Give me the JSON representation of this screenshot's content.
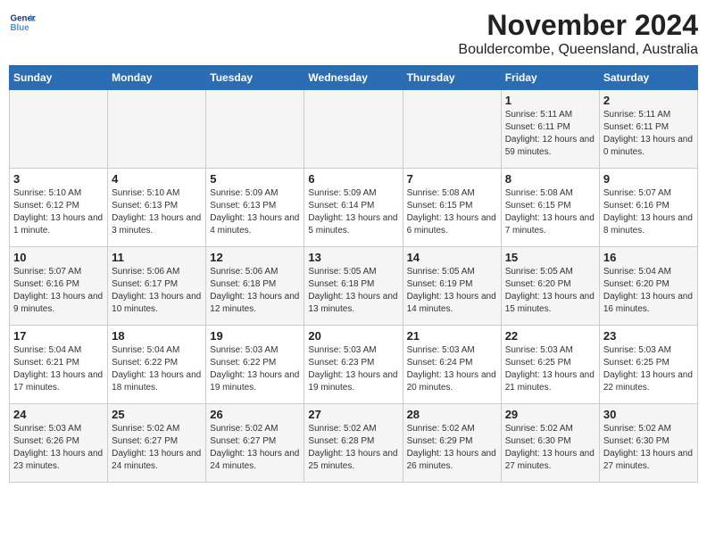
{
  "logo": {
    "line1": "General",
    "line2": "Blue"
  },
  "title": "November 2024",
  "location": "Bouldercombe, Queensland, Australia",
  "days_of_week": [
    "Sunday",
    "Monday",
    "Tuesday",
    "Wednesday",
    "Thursday",
    "Friday",
    "Saturday"
  ],
  "weeks": [
    [
      {
        "day": "",
        "info": ""
      },
      {
        "day": "",
        "info": ""
      },
      {
        "day": "",
        "info": ""
      },
      {
        "day": "",
        "info": ""
      },
      {
        "day": "",
        "info": ""
      },
      {
        "day": "1",
        "info": "Sunrise: 5:11 AM\nSunset: 6:11 PM\nDaylight: 12 hours and 59 minutes."
      },
      {
        "day": "2",
        "info": "Sunrise: 5:11 AM\nSunset: 6:11 PM\nDaylight: 13 hours and 0 minutes."
      }
    ],
    [
      {
        "day": "3",
        "info": "Sunrise: 5:10 AM\nSunset: 6:12 PM\nDaylight: 13 hours and 1 minute."
      },
      {
        "day": "4",
        "info": "Sunrise: 5:10 AM\nSunset: 6:13 PM\nDaylight: 13 hours and 3 minutes."
      },
      {
        "day": "5",
        "info": "Sunrise: 5:09 AM\nSunset: 6:13 PM\nDaylight: 13 hours and 4 minutes."
      },
      {
        "day": "6",
        "info": "Sunrise: 5:09 AM\nSunset: 6:14 PM\nDaylight: 13 hours and 5 minutes."
      },
      {
        "day": "7",
        "info": "Sunrise: 5:08 AM\nSunset: 6:15 PM\nDaylight: 13 hours and 6 minutes."
      },
      {
        "day": "8",
        "info": "Sunrise: 5:08 AM\nSunset: 6:15 PM\nDaylight: 13 hours and 7 minutes."
      },
      {
        "day": "9",
        "info": "Sunrise: 5:07 AM\nSunset: 6:16 PM\nDaylight: 13 hours and 8 minutes."
      }
    ],
    [
      {
        "day": "10",
        "info": "Sunrise: 5:07 AM\nSunset: 6:16 PM\nDaylight: 13 hours and 9 minutes."
      },
      {
        "day": "11",
        "info": "Sunrise: 5:06 AM\nSunset: 6:17 PM\nDaylight: 13 hours and 10 minutes."
      },
      {
        "day": "12",
        "info": "Sunrise: 5:06 AM\nSunset: 6:18 PM\nDaylight: 13 hours and 12 minutes."
      },
      {
        "day": "13",
        "info": "Sunrise: 5:05 AM\nSunset: 6:18 PM\nDaylight: 13 hours and 13 minutes."
      },
      {
        "day": "14",
        "info": "Sunrise: 5:05 AM\nSunset: 6:19 PM\nDaylight: 13 hours and 14 minutes."
      },
      {
        "day": "15",
        "info": "Sunrise: 5:05 AM\nSunset: 6:20 PM\nDaylight: 13 hours and 15 minutes."
      },
      {
        "day": "16",
        "info": "Sunrise: 5:04 AM\nSunset: 6:20 PM\nDaylight: 13 hours and 16 minutes."
      }
    ],
    [
      {
        "day": "17",
        "info": "Sunrise: 5:04 AM\nSunset: 6:21 PM\nDaylight: 13 hours and 17 minutes."
      },
      {
        "day": "18",
        "info": "Sunrise: 5:04 AM\nSunset: 6:22 PM\nDaylight: 13 hours and 18 minutes."
      },
      {
        "day": "19",
        "info": "Sunrise: 5:03 AM\nSunset: 6:22 PM\nDaylight: 13 hours and 19 minutes."
      },
      {
        "day": "20",
        "info": "Sunrise: 5:03 AM\nSunset: 6:23 PM\nDaylight: 13 hours and 19 minutes."
      },
      {
        "day": "21",
        "info": "Sunrise: 5:03 AM\nSunset: 6:24 PM\nDaylight: 13 hours and 20 minutes."
      },
      {
        "day": "22",
        "info": "Sunrise: 5:03 AM\nSunset: 6:25 PM\nDaylight: 13 hours and 21 minutes."
      },
      {
        "day": "23",
        "info": "Sunrise: 5:03 AM\nSunset: 6:25 PM\nDaylight: 13 hours and 22 minutes."
      }
    ],
    [
      {
        "day": "24",
        "info": "Sunrise: 5:03 AM\nSunset: 6:26 PM\nDaylight: 13 hours and 23 minutes."
      },
      {
        "day": "25",
        "info": "Sunrise: 5:02 AM\nSunset: 6:27 PM\nDaylight: 13 hours and 24 minutes."
      },
      {
        "day": "26",
        "info": "Sunrise: 5:02 AM\nSunset: 6:27 PM\nDaylight: 13 hours and 24 minutes."
      },
      {
        "day": "27",
        "info": "Sunrise: 5:02 AM\nSunset: 6:28 PM\nDaylight: 13 hours and 25 minutes."
      },
      {
        "day": "28",
        "info": "Sunrise: 5:02 AM\nSunset: 6:29 PM\nDaylight: 13 hours and 26 minutes."
      },
      {
        "day": "29",
        "info": "Sunrise: 5:02 AM\nSunset: 6:30 PM\nDaylight: 13 hours and 27 minutes."
      },
      {
        "day": "30",
        "info": "Sunrise: 5:02 AM\nSunset: 6:30 PM\nDaylight: 13 hours and 27 minutes."
      }
    ]
  ]
}
